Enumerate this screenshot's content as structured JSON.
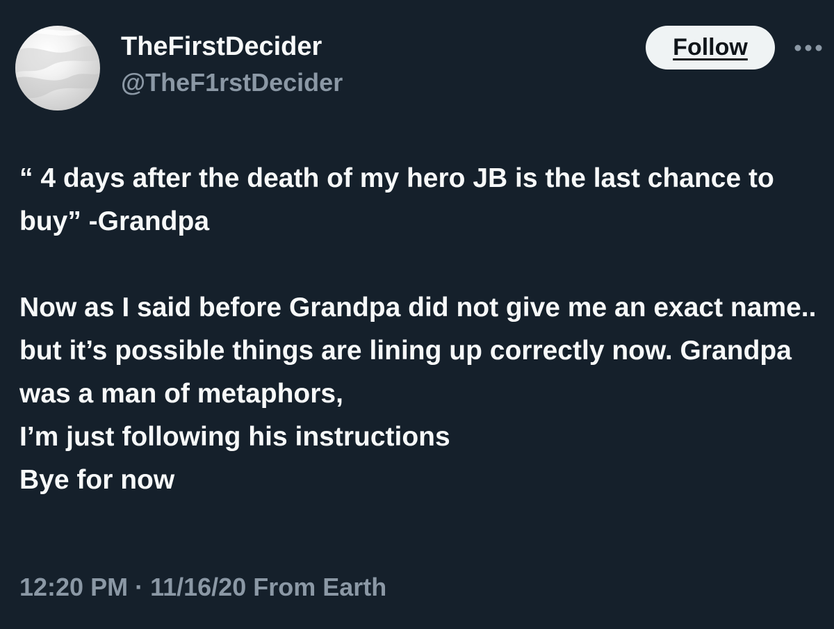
{
  "author": {
    "display_name": "TheFirstDecider",
    "handle": "@TheF1rstDecider"
  },
  "actions": {
    "follow_label": "Follow",
    "more_icon": "more-horizontal-icon"
  },
  "tweet": {
    "quote": "“ 4 days after the death of my hero JB is the last chance to buy” -Grandpa",
    "body_lines": [
      "Now as I said before Grandpa did not give me an exact name.. but it’s possible things are lining up correctly now. Grandpa was a man of metaphors,",
      "I’m just following his instructions",
      "Bye for now"
    ],
    "timestamp": "12:20 PM · 11/16/20 From Earth"
  },
  "colors": {
    "background": "#15202b",
    "primary_text": "#f7f9f9",
    "secondary_text": "#8b98a5",
    "follow_button_bg": "#eff3f4"
  }
}
